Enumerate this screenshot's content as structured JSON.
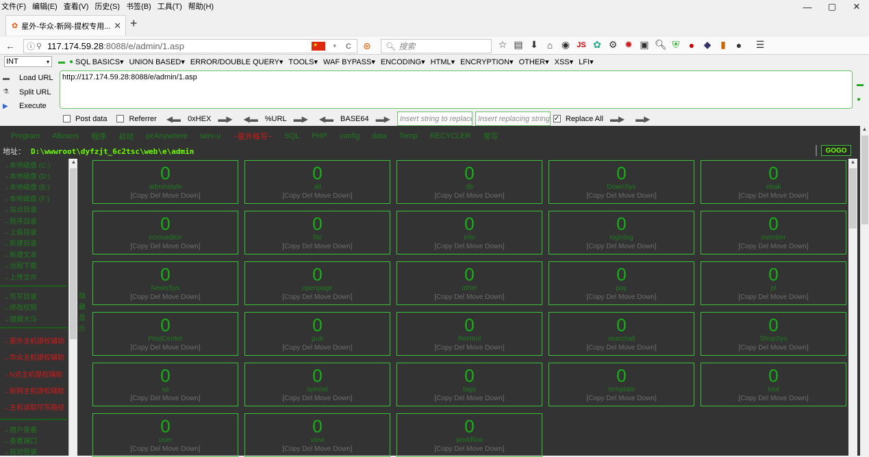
{
  "menus": [
    "文件(F)",
    "编辑(E)",
    "查看(V)",
    "历史(S)",
    "书签(B)",
    "工具(T)",
    "帮助(H)"
  ],
  "window_controls": [
    "—",
    "▢",
    "✕"
  ],
  "tab": {
    "favicon": "💅",
    "title": "星外-华众-新网-提权专用...",
    "close": "✕",
    "new": "+"
  },
  "nav": {
    "url_host": "117.174.59.28",
    "url_rest": ":8088/e/admin/1.asp",
    "search_placeholder": "搜索",
    "reload": "C"
  },
  "hackbar": {
    "select": "INT",
    "menus": [
      "SQL BASICS▾",
      "UNION BASED▾",
      "ERROR/DOUBLE QUERY▾",
      "TOOLS▾",
      "WAF BYPASS▾",
      "ENCODING▾",
      "HTML▾",
      "ENCRYPTION▾",
      "OTHER▾",
      "XSS▾",
      "LFI▾"
    ],
    "load_url": "Load URL",
    "split_url": "Split URL",
    "execute": "Execute",
    "url_value": "http://117.174.59.28:8088/e/admin/1.asp",
    "post_data": "Post data",
    "referrer": "Referrer",
    "hex": "0xHEX",
    "url_enc": "%URL",
    "base64": "BASE64",
    "insert_replace": "Insert string to replace",
    "insert_replacing": "Insert replacing string",
    "replace_all": "Replace All",
    "post_checked": false,
    "referrer_checked": false,
    "replace_all_checked": true
  },
  "webshell": {
    "topnav": [
      {
        "label": "Program",
        "red": false
      },
      {
        "label": "Allusers",
        "red": false
      },
      {
        "label": "程序",
        "red": false
      },
      {
        "label": "启动",
        "red": false
      },
      {
        "label": "pcAnywhere",
        "red": false
      },
      {
        "label": "serv-u",
        "red": false
      },
      {
        "label": "~星外每写~",
        "red": true
      },
      {
        "label": "SQL",
        "red": false
      },
      {
        "label": "PHP",
        "red": false
      },
      {
        "label": "config",
        "red": false
      },
      {
        "label": "data",
        "red": false
      },
      {
        "label": "Temp",
        "red": false
      },
      {
        "label": "RECYCLER",
        "red": false
      },
      {
        "label": "常写",
        "red": false
      }
    ],
    "addr_label": "地址：",
    "addr_value": "D:\\wwwroot\\dyfzjt_6c2tsc\\web\\e\\admin",
    "gogo": "GOGO",
    "sidebar_group1": [
      "→本地磁盘 (C:)",
      "→本地磁盘 (D:)",
      "→本地磁盘 (E:)",
      "→本地磁盘 (F:)",
      "→站点目录",
      "→程序目录",
      "→上级目录",
      "→新建目录",
      "→新建文本",
      "→远程下载",
      "→上传文件"
    ],
    "sidebar_group2": [
      "→可写目录",
      "→修改权限",
      "→搜藏大马"
    ],
    "sidebar_group3": [
      "→星外主机提权辅助",
      "→华众主机提权辅助",
      "→N点主机提权辅助",
      "→新网主机提权辅助",
      "→主机读取可写路径"
    ],
    "sidebar_group4": [
      "→用户查看",
      "→查看端口",
      "→自动登录"
    ],
    "mid_label": "隐藏显示",
    "action_text": "[Copy Del Move Down]",
    "folders": [
      {
        "count": "0",
        "name": "adminstyle"
      },
      {
        "count": "0",
        "name": "all"
      },
      {
        "count": "0",
        "name": "db"
      },
      {
        "count": "0",
        "name": "DownSys"
      },
      {
        "count": "0",
        "name": "ebak"
      },
      {
        "count": "0",
        "name": "ecmseditor"
      },
      {
        "count": "0",
        "name": "file"
      },
      {
        "count": "0",
        "name": "info"
      },
      {
        "count": "0",
        "name": "loginlog"
      },
      {
        "count": "0",
        "name": "member"
      },
      {
        "count": "0",
        "name": "NewsSys"
      },
      {
        "count": "0",
        "name": "openpage"
      },
      {
        "count": "0",
        "name": "other"
      },
      {
        "count": "0",
        "name": "pay"
      },
      {
        "count": "0",
        "name": "pl"
      },
      {
        "count": "0",
        "name": "PostCenter"
      },
      {
        "count": "0",
        "name": "pub"
      },
      {
        "count": "0",
        "name": "ReHtml"
      },
      {
        "count": "0",
        "name": "searchall"
      },
      {
        "count": "0",
        "name": "ShopSys"
      },
      {
        "count": "0",
        "name": "sp"
      },
      {
        "count": "0",
        "name": "special"
      },
      {
        "count": "0",
        "name": "tags"
      },
      {
        "count": "0",
        "name": "template"
      },
      {
        "count": "0",
        "name": "tool"
      },
      {
        "count": "0",
        "name": "user"
      },
      {
        "count": "0",
        "name": "view"
      },
      {
        "count": "0",
        "name": "workflow"
      }
    ]
  }
}
